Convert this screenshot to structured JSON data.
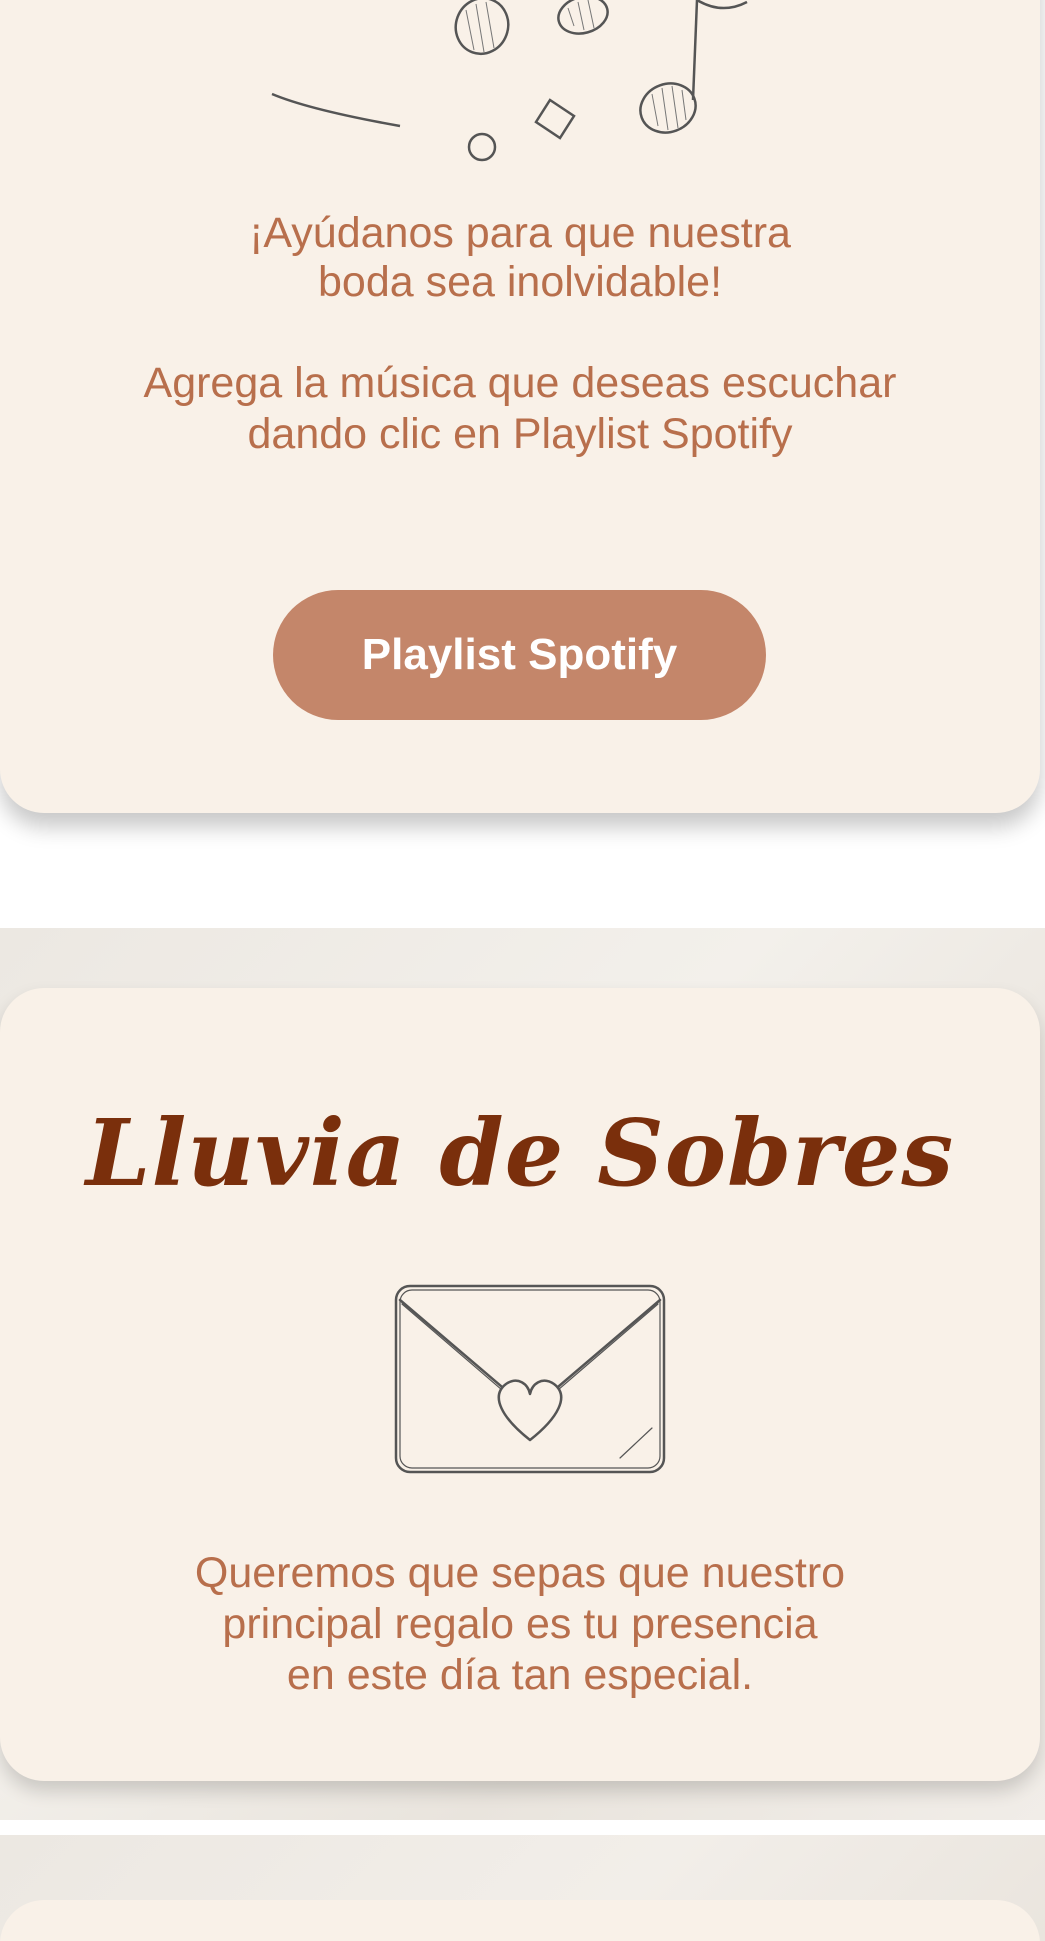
{
  "music_section": {
    "icon": "music-notes-icon",
    "title": "¡Ayúdanos para que nuestra\nboda sea inolvidable!",
    "description": "Agrega la música que deseas escuchar\ndando clic en Playlist Spotify",
    "button_label": "Playlist Spotify"
  },
  "sobres_section": {
    "title": "Lluvia de Sobres",
    "icon": "envelope-heart-icon",
    "description": "Queremos que sepas que nuestro\nprincipal regalo es tu presencia\nen este día tan especial."
  },
  "colors": {
    "card_background": "#f9f1e8",
    "text_accent": "#b86f4c",
    "button_background": "#c4866a",
    "script_title": "#7a2f0c"
  }
}
